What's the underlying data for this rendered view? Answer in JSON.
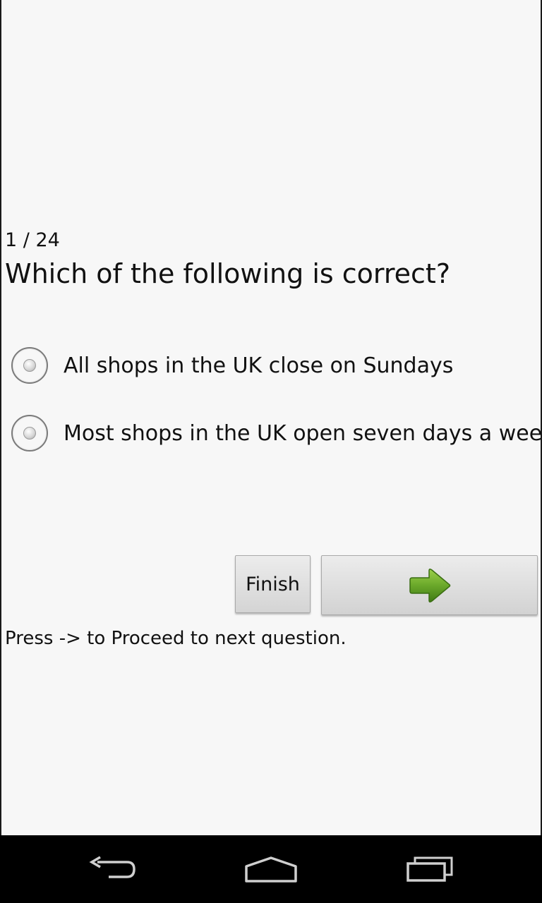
{
  "quiz": {
    "counter": "1 / 24",
    "question": "Which of the following is correct?",
    "options": [
      {
        "label": "All shops in the UK close on Sundays",
        "selected": false
      },
      {
        "label": "Most shops in the UK open seven days a week",
        "selected": false
      }
    ],
    "finish_label": "Finish",
    "next_icon": "right-arrow-icon",
    "hint": "Press -> to Proceed to next question."
  },
  "navbar": {
    "back_icon": "back-icon",
    "home_icon": "home-icon",
    "recents_icon": "recent-apps-icon"
  },
  "colors": {
    "background": "#f7f7f7",
    "arrow_green": "#5e9a1f",
    "navbar": "#000000"
  }
}
